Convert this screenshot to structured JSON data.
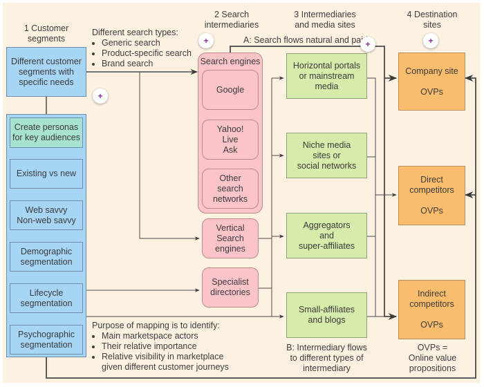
{
  "columns": {
    "customer_segments": "1 Customer\nsegments",
    "search_intermediaries": "2  Search\nintermediaries",
    "intermediaries_media": "3  Intermediaries\nand media sites",
    "destination_sites": "4  Destination\nsites"
  },
  "search_types": {
    "heading": "Different search types:",
    "items": [
      "Generic search",
      "Product-specific search",
      "Brand search"
    ]
  },
  "flow_a_label": "A:  Search flows natural and paid",
  "flow_b_label": "B:  Intermediary flows\nto different types of\nintermediary",
  "ovp_note": "OVPs =\nOnline value\npropositions",
  "customer": {
    "main_box": "Different customer\nsegments with\nspecific needs",
    "segments": [
      "Create personas\nfor key audiences",
      "Existing vs new",
      "Web savvy\nNon-web savvy",
      "Demographic\nsegmentation",
      "Lifecycle\nsegmentation",
      "Psychographic\nsegmentation"
    ]
  },
  "search_engines": {
    "group_label": "Search engines",
    "items": [
      "Google",
      "Yahoo!\nLive\nAsk",
      "Other\nsearch\nnetworks"
    ]
  },
  "other_search": [
    "Vertical\nSearch\nengines",
    "Specialist\ndirectories"
  ],
  "intermediaries": [
    "Horizontal portals\nor mainstream\nmedia",
    "Niche media\nsites or\nsocial networks",
    "Aggregators\nand\nsuper-affiliates",
    "Small-affiliates\nand blogs"
  ],
  "destinations": [
    "Company site\n\nOVPs",
    "Direct\ncompetitors\n\nOVPs",
    "Indirect\ncompetitors\n\nOVPs"
  ],
  "purpose": {
    "heading": "Purpose of mapping is to identify:",
    "items": [
      "Main marketspace actors",
      "Their relative importance",
      "Relative visibility in marketplace\ngiven different customer journeys"
    ]
  },
  "expand_icon_glyph": "+",
  "colors": {
    "customer_blue": "#a6d5f5",
    "persona_teal": "#a8e2d2",
    "search_pink": "#fbc4c9",
    "intermediary_green": "#d6ecaa",
    "destination_orange": "#f9bd6d",
    "background": "#fdf1e2",
    "plus_purple": "#8a2a9a"
  }
}
